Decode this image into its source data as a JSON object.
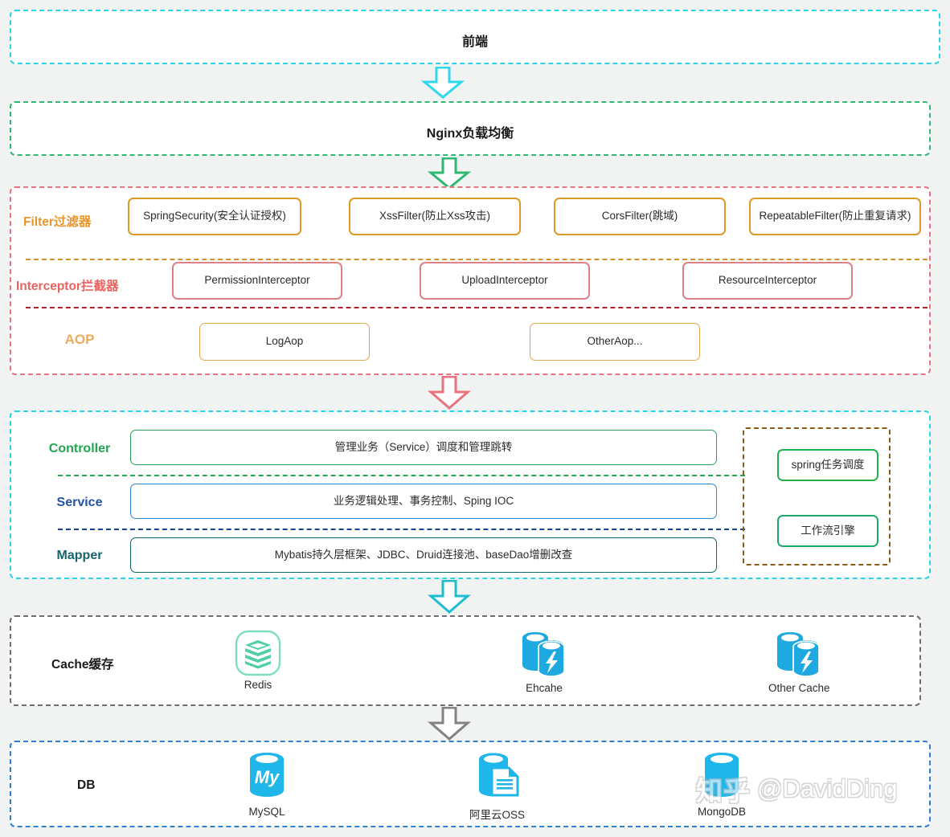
{
  "diagram": {
    "title": "前端",
    "background_color": "#f1f2f2",
    "watermark": {
      "logo_text": "知乎",
      "handle": "@DavidDing"
    }
  },
  "layers": {
    "frontend": {
      "label": "前端",
      "border_color": "#29d3e8",
      "style": "dashed"
    },
    "nginx": {
      "label": "Nginx负载均衡",
      "border_color": "#2eb872",
      "style": "dashed"
    },
    "filter_group": {
      "border_color": "#e8737f",
      "rows": [
        {
          "label": "Filter过滤器",
          "label_color": "#e8952a",
          "separator_color": "#d4912a",
          "items": [
            "SpringSecurity(安全认证授权)",
            "XssFilter(防止Xss攻击)",
            "CorsFilter(跳域)",
            "RepeatableFilter(防止重复请求)"
          ]
        },
        {
          "label": "Interceptor拦截器",
          "label_color": "#e8635f",
          "separator_color": "#b11e2b",
          "items": [
            "PermissionInterceptor",
            "UploadInterceptor",
            "ResourceInterceptor"
          ]
        },
        {
          "label": "AOP",
          "label_color": "#edab5a",
          "separator_color": "",
          "items": [
            "LogAop",
            "OtherAop..."
          ]
        }
      ]
    },
    "app_group": {
      "border_color": "#29d3e8",
      "rows": [
        {
          "label": "Controller",
          "label_color": "#22a451",
          "box_border": "#2e9e5b",
          "separator_color": "#22a94e",
          "description": "管理业务（Service）调度和管理跳转"
        },
        {
          "label": "Service",
          "label_color": "#2453a6",
          "box_border": "#2f84cf",
          "separator_color": "#1b3f8f",
          "description": "业务逻辑处理、事务控制、Sping IOC"
        },
        {
          "label": "Mapper",
          "label_color": "#15656c",
          "box_border": "#13666d",
          "separator_color": "",
          "description": "Mybatis持久层框架、JDBC、Druid连接池、baseDao增删改查"
        }
      ],
      "side_panel": {
        "border_color": "#8b5a17",
        "items": [
          {
            "label": "spring任务调度",
            "border_color": "#22b14c"
          },
          {
            "label": "工作流引擎",
            "border_color": "#1aab6b"
          }
        ]
      }
    },
    "cache_group": {
      "label": "Cache缓存",
      "border_color": "#6d6e71",
      "items": [
        {
          "label": "Redis",
          "icon": "redis-stack-icon",
          "icon_color": "#5fd4a8"
        },
        {
          "label": "Ehcahe",
          "icon": "cache-cylinders-bolt-icon",
          "icon_color": "#1ea9e1"
        },
        {
          "label": "Other Cache",
          "icon": "cache-cylinders-bolt-icon",
          "icon_color": "#1ea9e1"
        }
      ]
    },
    "db_group": {
      "label": "DB",
      "border_color": "#2f7fd1",
      "items": [
        {
          "label": "MySQL",
          "icon": "mysql-cylinder-icon",
          "icon_color": "#1fb6ea",
          "glyph": "My"
        },
        {
          "label": "阿里云OSS",
          "icon": "oss-document-cylinder-icon",
          "icon_color": "#1fb6ea",
          "glyph": ""
        },
        {
          "label": "MongoDB",
          "icon": "mongodb-cylinder-icon",
          "icon_color": "#1fb6ea",
          "glyph": ""
        }
      ]
    }
  },
  "arrows": [
    {
      "name": "frontend-to-nginx",
      "color": "#2fd8ea"
    },
    {
      "name": "nginx-to-filter",
      "color": "#2eb872"
    },
    {
      "name": "aop-to-controller",
      "color": "#e8737f"
    },
    {
      "name": "mapper-to-cache",
      "color": "#1fbcd0"
    },
    {
      "name": "cache-to-db",
      "color": "#808285"
    }
  ]
}
